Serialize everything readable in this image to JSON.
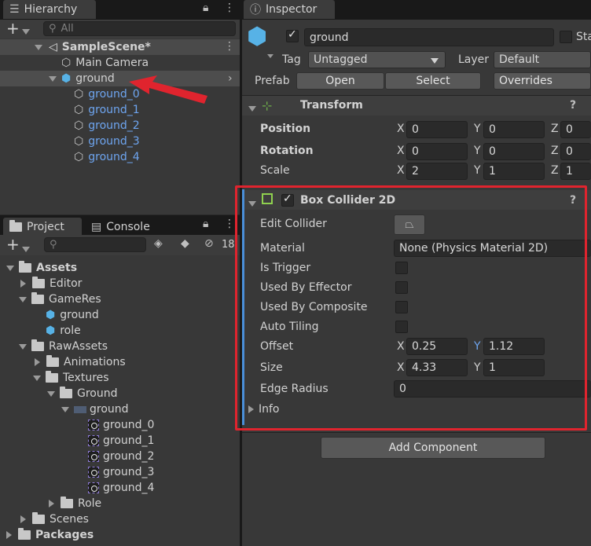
{
  "hierarchy": {
    "tab_label": "Hierarchy",
    "search_placeholder": "All",
    "scene": "SampleScene*",
    "items": [
      "Main Camera",
      "ground"
    ],
    "children": [
      "ground_0",
      "ground_1",
      "ground_2",
      "ground_3",
      "ground_4"
    ]
  },
  "project": {
    "tab_label": "Project",
    "console_label": "Console",
    "badge_count": "18",
    "tree": {
      "assets": "Assets",
      "editor": "Editor",
      "gameres": "GameRes",
      "ground": "ground",
      "role": "role",
      "rawassets": "RawAssets",
      "animations": "Animations",
      "textures": "Textures",
      "ground_folder": "Ground",
      "ground_texture": "ground",
      "sprites": [
        "ground_0",
        "ground_1",
        "ground_2",
        "ground_3",
        "ground_4"
      ],
      "role_folder": "Role",
      "scenes": "Scenes",
      "packages": "Packages"
    }
  },
  "inspector": {
    "tab_label": "Inspector",
    "object_name": "ground",
    "static_label": "Sta",
    "tag_label": "Tag",
    "tag_value": "Untagged",
    "layer_label": "Layer",
    "layer_value": "Default",
    "prefab_label": "Prefab",
    "open_label": "Open",
    "select_label": "Select",
    "overrides_label": "Overrides",
    "transform": {
      "title": "Transform",
      "position_label": "Position",
      "rotation_label": "Rotation",
      "scale_label": "Scale",
      "position": {
        "x": "0",
        "y": "0",
        "z": "0"
      },
      "rotation": {
        "x": "0",
        "y": "0",
        "z": "0"
      },
      "scale": {
        "x": "2",
        "y": "1",
        "z": "1"
      }
    },
    "collider": {
      "title": "Box Collider 2D",
      "edit_collider": "Edit Collider",
      "material_label": "Material",
      "material_value": "None (Physics Material 2D)",
      "is_trigger": "Is Trigger",
      "used_by_effector": "Used By Effector",
      "used_by_composite": "Used By Composite",
      "auto_tiling": "Auto Tiling",
      "offset_label": "Offset",
      "offset": {
        "x": "0.25",
        "y": "1.12"
      },
      "size_label": "Size",
      "size": {
        "x": "4.33",
        "y": "1"
      },
      "edge_radius_label": "Edge Radius",
      "edge_radius": "0",
      "info_label": "Info"
    },
    "add_component": "Add Component"
  },
  "axes": {
    "x": "X",
    "y": "Y",
    "z": "Z"
  },
  "help": "?",
  "colors": {
    "accent_blue": "#6ea5f0",
    "highlight_red": "#e0242e",
    "cube": "#57b2e6"
  }
}
